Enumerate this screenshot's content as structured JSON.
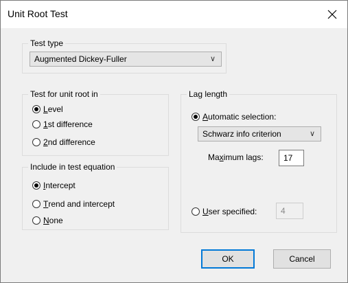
{
  "window": {
    "title": "Unit Root Test"
  },
  "test_type": {
    "group_label": "Test type",
    "selected": "Augmented Dickey-Fuller"
  },
  "unit_root_in": {
    "group_label": "Test for unit root in",
    "options": [
      {
        "mnemonic": "L",
        "rest": "evel",
        "selected": true
      },
      {
        "mnemonic": "1",
        "rest": "st difference",
        "selected": false
      },
      {
        "mnemonic": "2",
        "rest": "nd difference",
        "selected": false
      }
    ]
  },
  "include": {
    "group_label": "Include in test equation",
    "options": [
      {
        "mnemonic": "I",
        "rest": "ntercept",
        "selected": true
      },
      {
        "mnemonic": "T",
        "rest": "rend and intercept",
        "selected": false
      },
      {
        "mnemonic": "N",
        "rest": "one",
        "selected": false
      }
    ]
  },
  "lag_length": {
    "group_label": "Lag length",
    "automatic": {
      "mnemonic": "A",
      "rest": "utomatic selection:",
      "selected": true
    },
    "criterion": "Schwarz info criterion",
    "max_lags": {
      "pre": "Ma",
      "mnemonic": "x",
      "post": "imum lags:",
      "value": "17"
    },
    "user": {
      "mnemonic": "U",
      "rest": "ser specified:",
      "selected": false,
      "value": "4"
    }
  },
  "buttons": {
    "ok": "OK",
    "cancel": "Cancel"
  },
  "icons": {
    "close": "close-icon",
    "chevron": "chevron-down-icon"
  }
}
